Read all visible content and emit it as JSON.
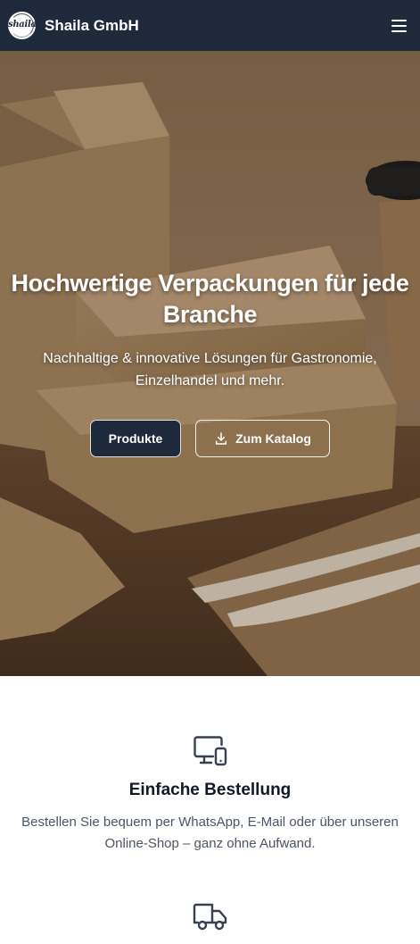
{
  "header": {
    "logo_text": "shaila",
    "brand": "Shaila GmbH",
    "menu_icon": "hamburger-menu-icon",
    "background": "#1e293b"
  },
  "hero": {
    "title": "Hochwertige Verpackungen für jede Branche",
    "subtitle": "Nachhaltige & innovative Lösungen für Gastronomie, Einzelhandel und mehr.",
    "primary_button": "Produkte",
    "secondary_button": "Zum Katalog",
    "secondary_button_icon": "download-icon"
  },
  "features": [
    {
      "icon": "devices-icon",
      "title": "Einfache Bestellung",
      "text": "Bestellen Sie bequem per WhatsApp, E-Mail oder über unseren Online-Shop – ganz ohne Aufwand."
    },
    {
      "icon": "truck-icon"
    }
  ],
  "colors": {
    "primary": "#1e293b",
    "text_dark": "#111827",
    "text_muted": "#4b5563"
  }
}
